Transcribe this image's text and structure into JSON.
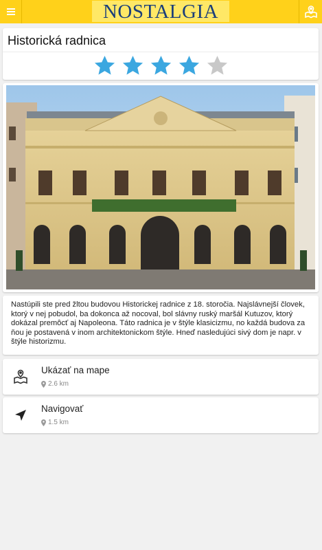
{
  "header": {
    "brand": "NOSTALGIA",
    "menu_icon": "hamburger-icon",
    "map_icon": "map-pin-icon"
  },
  "place": {
    "title": "Historická radnica",
    "rating": 4,
    "rating_max": 5,
    "photo": "Historic town hall building, yellow neoclassical facade",
    "description": "Nastúpili ste pred žltou budovou Historickej radnice z 18. storočia. Najslávnejší človek, ktorý v nej pobudol, ba dokonca až nocoval, bol slávny ruský maršál Kutuzov, ktorý dokázal premôcť aj Napoleona. Táto radnica je v štýle klasicizmu, no každá budova za ňou je postavená v inom architektonickom  štýle. Hneď nasledujúci sivý dom je napr. v štýle historizmu."
  },
  "actions": [
    {
      "label": "Ukázať na mape",
      "distance": "2.6 km",
      "icon": "map-icon"
    },
    {
      "label": "Navigovať",
      "distance": "1.5 km",
      "icon": "navigation-arrow-icon"
    }
  ],
  "colors": {
    "topbar": "#ffd11a",
    "brand_bg": "#ffe866",
    "brand_text": "#1b3f7a",
    "star_filled": "#3ba7e0",
    "star_empty": "#c8c8c8",
    "background": "#f1f1f1"
  }
}
